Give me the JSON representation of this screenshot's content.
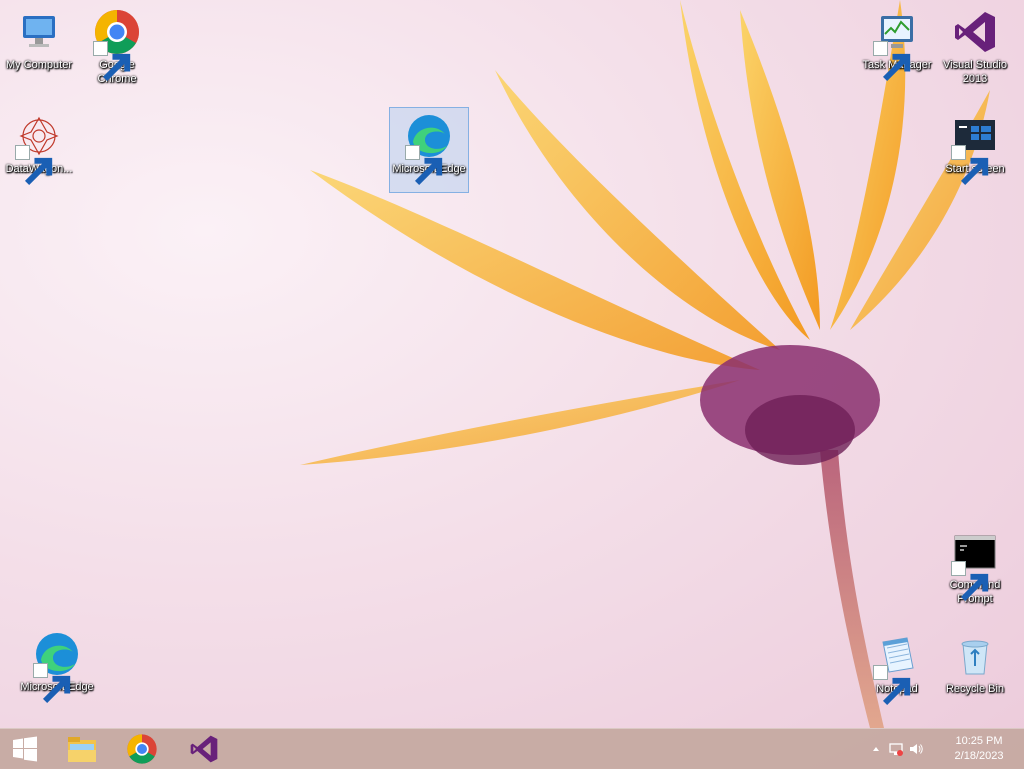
{
  "desktop": {
    "icons": [
      {
        "id": "my-computer",
        "label": "My Computer"
      },
      {
        "id": "google-chrome",
        "label": "Google Chrome"
      },
      {
        "id": "datawagon",
        "label": "DataWagon..."
      },
      {
        "id": "microsoft-edge-selected",
        "label": "Microsoft Edge"
      },
      {
        "id": "task-manager",
        "label": "Task Manager"
      },
      {
        "id": "visual-studio",
        "label": "Visual Studio 2013"
      },
      {
        "id": "start-screen",
        "label": "Start screen"
      },
      {
        "id": "command-prompt",
        "label": "Command Prompt"
      },
      {
        "id": "microsoft-edge",
        "label": "Microsoft Edge"
      },
      {
        "id": "notepad",
        "label": "Notepad"
      },
      {
        "id": "recycle-bin",
        "label": "Recycle Bin"
      }
    ]
  },
  "taskbar": {
    "pinned": [
      "start-icon",
      "file-explorer-icon",
      "chrome-icon",
      "visual-studio-icon"
    ],
    "clock": {
      "time": "10:25 PM",
      "date": "2/18/2023"
    }
  },
  "colors": {
    "taskbar": "#c4a8a0",
    "selection": "#aacdf0",
    "petal": "#f7b23a",
    "flower_center": "#8a2f6e"
  }
}
